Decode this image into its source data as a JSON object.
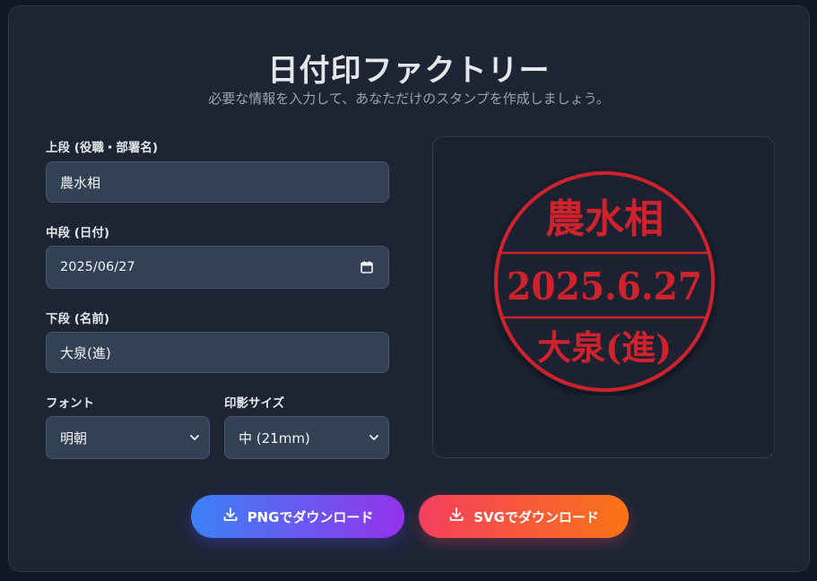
{
  "title": "日付印ファクトリー",
  "subtitle": "必要な情報を入力して、あなただけのスタンプを作成しましょう。",
  "form": {
    "top": {
      "label": "上段 (役職・部署名)",
      "value": "農水相"
    },
    "middle": {
      "label": "中段 (日付)",
      "value": "2025/06/27"
    },
    "bottom": {
      "label": "下段 (名前)",
      "value": "大泉(進)"
    },
    "font": {
      "label": "フォント",
      "value": "明朝"
    },
    "size": {
      "label": "印影サイズ",
      "value": "中 (21mm)"
    }
  },
  "stamp": {
    "top_text": "農水相",
    "date_text": "2025.6.27",
    "bottom_text": "大泉(進)",
    "color": "#d0222c"
  },
  "buttons": {
    "png": "PNGでダウンロード",
    "svg": "SVGでダウンロード"
  },
  "icons": {
    "date_picker": "calendar-icon",
    "select": "chevron-down-icon",
    "download": "download-icon"
  }
}
